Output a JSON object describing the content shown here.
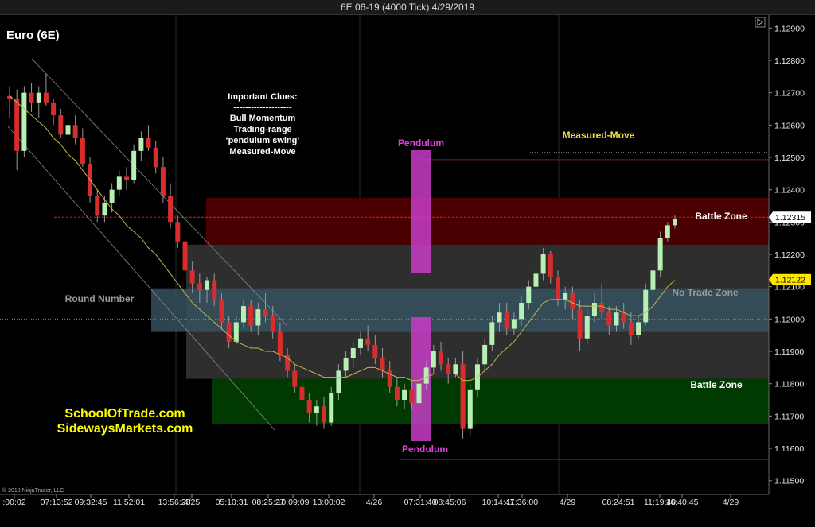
{
  "window": {
    "title": "6E 06-19 (4000 Tick)  4/29/2019"
  },
  "instrument": "Euro (6E)",
  "copyright": "© 2019 NinjaTrader, LLC",
  "colors": {
    "background": "#000000",
    "bull_candle": "#b7f0b5",
    "bear_candle": "#d92d2d",
    "moving_average": "#c8b44a",
    "pendulum": "#c83cc8",
    "upper_battle_zone": "#4a0000",
    "middle_zone": "#2e2e2e",
    "no_trade_zone": "#35505f",
    "lower_battle_zone": "#003a00",
    "measured_move_text": "#f0e040",
    "price_marker_current": "#ffffff",
    "price_marker_ma": "#ffe600"
  },
  "chart_data": {
    "type": "candlestick",
    "y_axis": {
      "range": [
        1.1146,
        1.1294
      ],
      "ticks": [
        "1.12900",
        "1.12800",
        "1.12700",
        "1.12600",
        "1.12500",
        "1.12400",
        "1.12300",
        "1.12200",
        "1.12100",
        "1.12000",
        "1.11900",
        "1.11800",
        "1.11700",
        "1.11600",
        "1.11500"
      ]
    },
    "price_markers": [
      {
        "label": "1.12315",
        "value": 1.12315,
        "kind": "last_price"
      },
      {
        "label": "1.12122",
        "value": 1.12122,
        "kind": "moving_average"
      }
    ],
    "x_axis": {
      "labels": [
        ":00:02",
        "07:13:52",
        "09:32:45",
        "11:52:01",
        "13:56:28",
        "4/25",
        "05:10:31",
        "08:25:27",
        "10:09:09",
        "13:00:02",
        "4/26",
        "07:31:40",
        "08:45:06",
        "10:14:47",
        "11:36:00",
        "4/29",
        "08:24:51",
        "11:19:40",
        "16:40:45",
        "4/29"
      ]
    },
    "zones": [
      {
        "name": "Battle Zone",
        "y_top": 1.12375,
        "y_bottom": 1.1223
      },
      {
        "name": "Trading Range",
        "y_top": 1.1223,
        "y_bottom": 1.11815
      },
      {
        "name": "No Trade Zone",
        "y_top": 1.12095,
        "y_bottom": 1.1196
      },
      {
        "name": "Battle Zone",
        "y_top": 1.11815,
        "y_bottom": 1.11675
      }
    ],
    "levels": [
      {
        "name": "Measured-Move",
        "value": 1.12515
      },
      {
        "name": "Round Number",
        "value": 1.12
      }
    ],
    "annotations": {
      "clues": [
        "Important Clues:",
        "--------------------",
        "Bull Momentum",
        "Trading-range",
        "‘pendulum swing’",
        "Measured-Move"
      ],
      "pendulum_top": "Pendulum",
      "pendulum_bottom": "Pendulum",
      "measured_move": "Measured-Move",
      "upper_battle_zone": "Battle Zone",
      "no_trade_zone": "No Trade Zone",
      "lower_battle_zone": "Battle Zone",
      "round_number": "Round Number",
      "watermark": [
        "SchoolOfTrade.com",
        "SidewaysMarkets.com"
      ]
    },
    "candles": [
      [
        1.1269,
        1.1272,
        1.1262,
        1.1268
      ],
      [
        1.1268,
        1.1271,
        1.1246,
        1.1252
      ],
      [
        1.1252,
        1.1272,
        1.125,
        1.127
      ],
      [
        1.127,
        1.1273,
        1.1264,
        1.1267
      ],
      [
        1.1267,
        1.1272,
        1.1262,
        1.127
      ],
      [
        1.127,
        1.1276,
        1.1266,
        1.1267
      ],
      [
        1.1267,
        1.1268,
        1.126,
        1.1263
      ],
      [
        1.1263,
        1.1265,
        1.1256,
        1.1257
      ],
      [
        1.1257,
        1.1262,
        1.1254,
        1.126
      ],
      [
        1.126,
        1.1263,
        1.1254,
        1.1256
      ],
      [
        1.1256,
        1.1259,
        1.1247,
        1.1248
      ],
      [
        1.1248,
        1.125,
        1.1236,
        1.1238
      ],
      [
        1.1238,
        1.124,
        1.123,
        1.1232
      ],
      [
        1.1232,
        1.1238,
        1.123,
        1.1236
      ],
      [
        1.1236,
        1.1242,
        1.1233,
        1.124
      ],
      [
        1.124,
        1.1246,
        1.1238,
        1.1244
      ],
      [
        1.1244,
        1.1247,
        1.124,
        1.1243
      ],
      [
        1.1243,
        1.1254,
        1.1242,
        1.1252
      ],
      [
        1.1252,
        1.1258,
        1.1249,
        1.1256
      ],
      [
        1.1256,
        1.126,
        1.1252,
        1.1253
      ],
      [
        1.1253,
        1.1255,
        1.1245,
        1.1247
      ],
      [
        1.1247,
        1.125,
        1.1236,
        1.1238
      ],
      [
        1.1238,
        1.1242,
        1.1228,
        1.123
      ],
      [
        1.123,
        1.1232,
        1.1222,
        1.1224
      ],
      [
        1.1224,
        1.1226,
        1.1213,
        1.1215
      ],
      [
        1.1215,
        1.1218,
        1.1208,
        1.1211
      ],
      [
        1.1211,
        1.1214,
        1.1205,
        1.1209
      ],
      [
        1.1209,
        1.1213,
        1.1205,
        1.1212
      ],
      [
        1.1212,
        1.1214,
        1.1204,
        1.1206
      ],
      [
        1.1206,
        1.1208,
        1.1197,
        1.1199
      ],
      [
        1.1199,
        1.1201,
        1.1191,
        1.1193
      ],
      [
        1.1193,
        1.1201,
        1.1192,
        1.1199
      ],
      [
        1.1199,
        1.1206,
        1.1197,
        1.1204
      ],
      [
        1.1204,
        1.1206,
        1.1196,
        1.1198
      ],
      [
        1.1198,
        1.1205,
        1.1195,
        1.1203
      ],
      [
        1.1203,
        1.1208,
        1.1199,
        1.1201
      ],
      [
        1.1201,
        1.1204,
        1.1194,
        1.1196
      ],
      [
        1.1196,
        1.1199,
        1.1187,
        1.1189
      ],
      [
        1.1189,
        1.1191,
        1.1182,
        1.1184
      ],
      [
        1.1184,
        1.1186,
        1.1177,
        1.1179
      ],
      [
        1.1179,
        1.1181,
        1.1173,
        1.1175
      ],
      [
        1.1175,
        1.1177,
        1.1168,
        1.1171
      ],
      [
        1.1171,
        1.1175,
        1.1167,
        1.1173
      ],
      [
        1.1173,
        1.1176,
        1.1166,
        1.1168
      ],
      [
        1.1168,
        1.1179,
        1.1167,
        1.1177
      ],
      [
        1.1177,
        1.1186,
        1.1175,
        1.1184
      ],
      [
        1.1184,
        1.119,
        1.1182,
        1.1188
      ],
      [
        1.1188,
        1.1193,
        1.1185,
        1.1191
      ],
      [
        1.1191,
        1.1196,
        1.1189,
        1.1194
      ],
      [
        1.1194,
        1.1198,
        1.119,
        1.1192
      ],
      [
        1.1192,
        1.1195,
        1.1186,
        1.1188
      ],
      [
        1.1188,
        1.1191,
        1.1182,
        1.1184
      ],
      [
        1.1184,
        1.1187,
        1.1177,
        1.1179
      ],
      [
        1.1179,
        1.1182,
        1.1173,
        1.1175
      ],
      [
        1.1175,
        1.118,
        1.1172,
        1.1178
      ],
      [
        1.1178,
        1.1181,
        1.1172,
        1.1174
      ],
      [
        1.1174,
        1.1182,
        1.1173,
        1.118
      ],
      [
        1.118,
        1.1187,
        1.1178,
        1.1185
      ],
      [
        1.1185,
        1.1192,
        1.1183,
        1.119
      ],
      [
        1.119,
        1.1193,
        1.1184,
        1.1186
      ],
      [
        1.1186,
        1.1188,
        1.118,
        1.1183
      ],
      [
        1.1183,
        1.1188,
        1.1182,
        1.1186
      ],
      [
        1.1186,
        1.119,
        1.1163,
        1.1166
      ],
      [
        1.1166,
        1.118,
        1.1164,
        1.1178
      ],
      [
        1.1178,
        1.1188,
        1.1176,
        1.1186
      ],
      [
        1.1186,
        1.1194,
        1.1184,
        1.1192
      ],
      [
        1.1192,
        1.1201,
        1.119,
        1.1199
      ],
      [
        1.1199,
        1.1205,
        1.1196,
        1.1202
      ],
      [
        1.1202,
        1.1205,
        1.1195,
        1.1197
      ],
      [
        1.1197,
        1.1202,
        1.1195,
        1.12
      ],
      [
        1.12,
        1.1207,
        1.1198,
        1.1205
      ],
      [
        1.1205,
        1.1212,
        1.1203,
        1.121
      ],
      [
        1.121,
        1.1216,
        1.1208,
        1.1214
      ],
      [
        1.1214,
        1.1222,
        1.1212,
        1.122
      ],
      [
        1.122,
        1.1221,
        1.1211,
        1.1213
      ],
      [
        1.1213,
        1.1215,
        1.1204,
        1.1206
      ],
      [
        1.1206,
        1.121,
        1.1203,
        1.1208
      ],
      [
        1.1208,
        1.121,
        1.12,
        1.1203
      ],
      [
        1.1203,
        1.1206,
        1.119,
        1.1194
      ],
      [
        1.1194,
        1.1203,
        1.1192,
        1.1201
      ],
      [
        1.1201,
        1.1208,
        1.1199,
        1.1205
      ],
      [
        1.1205,
        1.1211,
        1.12,
        1.1202
      ],
      [
        1.1202,
        1.1204,
        1.1195,
        1.1198
      ],
      [
        1.1198,
        1.1204,
        1.1196,
        1.1202
      ],
      [
        1.1202,
        1.1205,
        1.1197,
        1.1199
      ],
      [
        1.1199,
        1.1202,
        1.1192,
        1.1195
      ],
      [
        1.1195,
        1.1201,
        1.1194,
        1.1199
      ],
      [
        1.1199,
        1.1211,
        1.1198,
        1.1209
      ],
      [
        1.1209,
        1.1217,
        1.1207,
        1.1215
      ],
      [
        1.1215,
        1.1227,
        1.1213,
        1.1225
      ],
      [
        1.1225,
        1.123,
        1.1224,
        1.1229
      ],
      [
        1.1229,
        1.1232,
        1.1228,
        1.1231
      ]
    ],
    "moving_average": [
      1.1269,
      1.1267,
      1.1265,
      1.1263,
      1.1261,
      1.1259,
      1.1256,
      1.1254,
      1.1251,
      1.1249,
      1.1246,
      1.1243,
      1.124,
      1.1237,
      1.1234,
      1.1232,
      1.1229,
      1.1227,
      1.1225,
      1.1222,
      1.122,
      1.1217,
      1.1214,
      1.1211,
      1.1208,
      1.1205,
      1.1203,
      1.1201,
      1.1199,
      1.1197,
      1.1195,
      1.1193,
      1.1192,
      1.1191,
      1.1191,
      1.119,
      1.119,
      1.1189,
      1.1188,
      1.1186,
      1.1185,
      1.1184,
      1.1183,
      1.1182,
      1.1182,
      1.1182,
      1.1182,
      1.1183,
      1.1184,
      1.1185,
      1.1185,
      1.1184,
      1.1183,
      1.1182,
      1.1182,
      1.1181,
      1.1181,
      1.1182,
      1.1183,
      1.1183,
      1.1183,
      1.1183,
      1.1181,
      1.1181,
      1.1182,
      1.1184,
      1.1186,
      1.1189,
      1.1191,
      1.1193,
      1.1196,
      1.1199,
      1.1202,
      1.1205,
      1.1206,
      1.1206,
      1.1206,
      1.1205,
      1.1204,
      1.1204,
      1.1204,
      1.1204,
      1.1203,
      1.1203,
      1.1202,
      1.1201,
      1.1201,
      1.1202,
      1.1204,
      1.1207,
      1.121,
      1.1212
    ]
  }
}
